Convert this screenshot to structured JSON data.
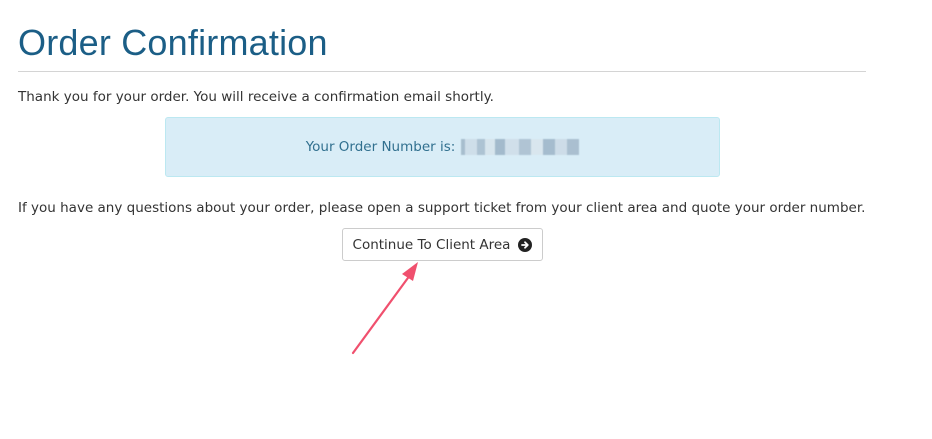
{
  "page": {
    "title": "Order Confirmation",
    "thank_you_text": "Thank you for your order. You will receive a confirmation email shortly.",
    "order_alert": {
      "label": "Your Order Number is:"
    },
    "questions_text": "If you have any questions about your order, please open a support ticket from your client area and quote your order number.",
    "continue_button": {
      "label": "Continue To Client Area",
      "icon": "arrow-circle-right-icon"
    }
  },
  "colors": {
    "title": "#1b5e86",
    "alert_bg": "#d9edf7",
    "alert_text": "#31708f",
    "annotation_arrow": "#f0506e"
  }
}
